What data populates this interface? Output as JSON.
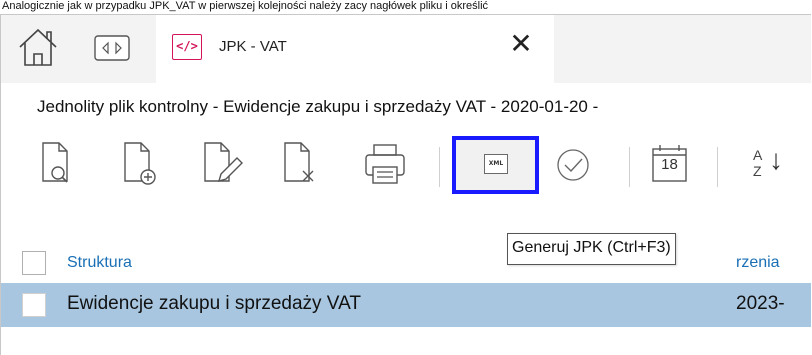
{
  "caption": "Analogicznie jak w przypadku JPK_VAT w pierwszej kolejności należy zacy nagłówek pliku i określić",
  "tabs": {
    "home_icon": "home-icon",
    "nav_icon": "nav-toggle-icon",
    "active": {
      "icon_text": "</>",
      "title": "JPK - VAT",
      "close": "✕"
    }
  },
  "document": {
    "title": "Jednolity plik kontrolny - Ewidencje zakupu i sprzedaży VAT - 2020-01-20 -"
  },
  "toolbar": {
    "items": [
      {
        "name": "preview",
        "icon": "document-search-icon"
      },
      {
        "name": "add",
        "icon": "document-add-icon"
      },
      {
        "name": "edit",
        "icon": "document-edit-icon"
      },
      {
        "name": "delete",
        "icon": "document-delete-icon"
      },
      {
        "name": "print",
        "icon": "printer-icon"
      },
      {
        "name": "generate",
        "icon": "xml-file-icon",
        "icon_text": "XML"
      },
      {
        "name": "verify",
        "icon": "check-circle-icon"
      },
      {
        "name": "calendar",
        "icon": "calendar-icon",
        "day": "18"
      },
      {
        "name": "sort",
        "icon": "sort-az-icon",
        "a": "A",
        "z": "Z",
        "arrow": "↓"
      }
    ],
    "tooltip": "Generuj JPK (Ctrl+F3)"
  },
  "grid": {
    "columns": [
      "Struktura",
      "rzenia"
    ],
    "rows": [
      {
        "name": "Ewidencje zakupu i sprzedaży VAT",
        "date": "2023-"
      }
    ]
  },
  "colors": {
    "accent_tab_icon": "#d4145a",
    "highlight_border": "#1a1aff",
    "selected_row": "#a8c6e0",
    "link_header": "#1a6fb5"
  }
}
